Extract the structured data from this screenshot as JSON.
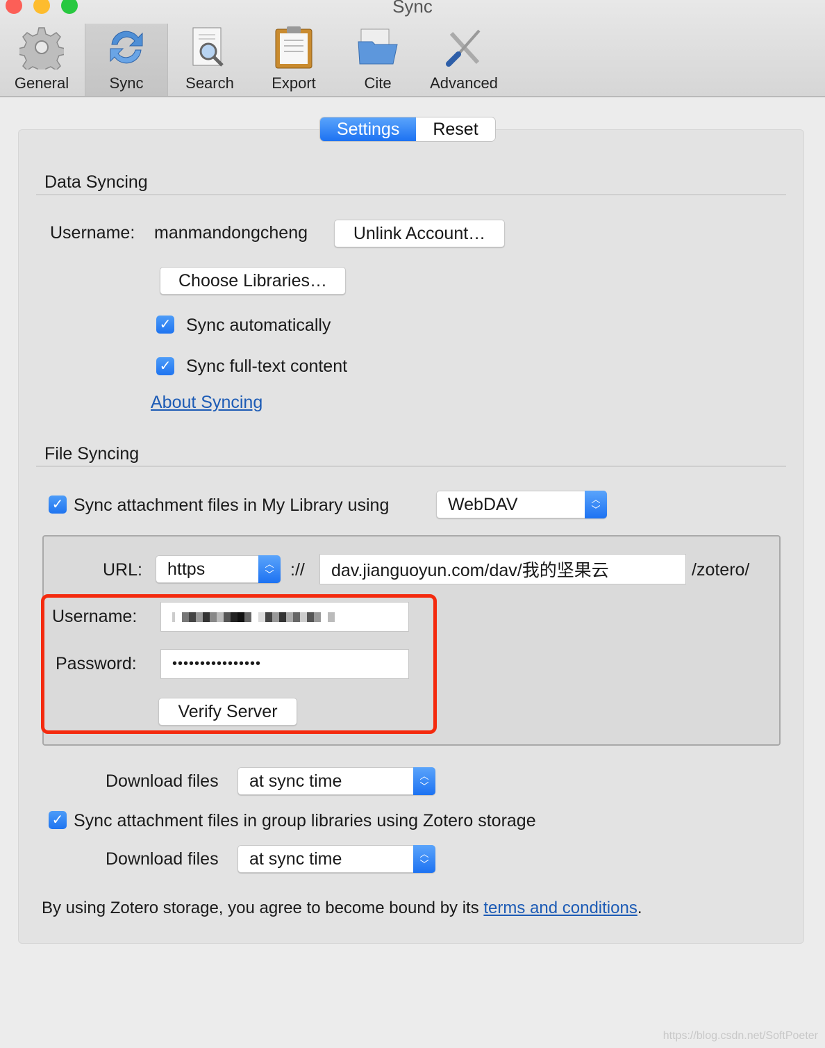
{
  "window": {
    "title": "Sync"
  },
  "toolbar": {
    "items": [
      {
        "label": "General",
        "icon": "gear-icon"
      },
      {
        "label": "Sync",
        "icon": "sync-icon",
        "selected": true
      },
      {
        "label": "Search",
        "icon": "search-icon"
      },
      {
        "label": "Export",
        "icon": "clipboard-icon"
      },
      {
        "label": "Cite",
        "icon": "folder-icon"
      },
      {
        "label": "Advanced",
        "icon": "tools-icon"
      }
    ]
  },
  "tabs": {
    "settings": "Settings",
    "reset": "Reset",
    "active": "Settings"
  },
  "data_syncing": {
    "header": "Data Syncing",
    "username_label": "Username:",
    "username": "manmandongcheng",
    "unlink": "Unlink Account…",
    "choose_libraries": "Choose Libraries…",
    "sync_auto": "Sync automatically",
    "sync_auto_checked": true,
    "sync_fulltext": "Sync full-text content",
    "sync_fulltext_checked": true,
    "about": "About Syncing"
  },
  "file_syncing": {
    "header": "File Syncing",
    "sync_attachments": "Sync attachment files in My Library using",
    "sync_attachments_checked": true,
    "method": "WebDAV",
    "url_label": "URL:",
    "protocol": "https",
    "sep": "://",
    "url": "dav.jianguoyun.com/dav/我的坚果云",
    "suffix": "/zotero/",
    "username_label": "Username:",
    "password_label": "Password:",
    "password": "••••••••••••••••",
    "verify": "Verify Server",
    "download_label": "Download files",
    "download_value": "at sync time",
    "group_sync": "Sync attachment files in group libraries using Zotero storage",
    "group_sync_checked": true,
    "group_download_label": "Download files",
    "group_download_value": "at sync time",
    "terms_prefix": "By using Zotero storage, you agree to become bound by its ",
    "terms_link": "terms and conditions",
    "terms_suffix": "."
  },
  "colors": {
    "accent": "#1d72f2",
    "highlight": "#f42a0e",
    "link": "#1c5bb5"
  },
  "watermark": "https://blog.csdn.net/SoftPoeter"
}
